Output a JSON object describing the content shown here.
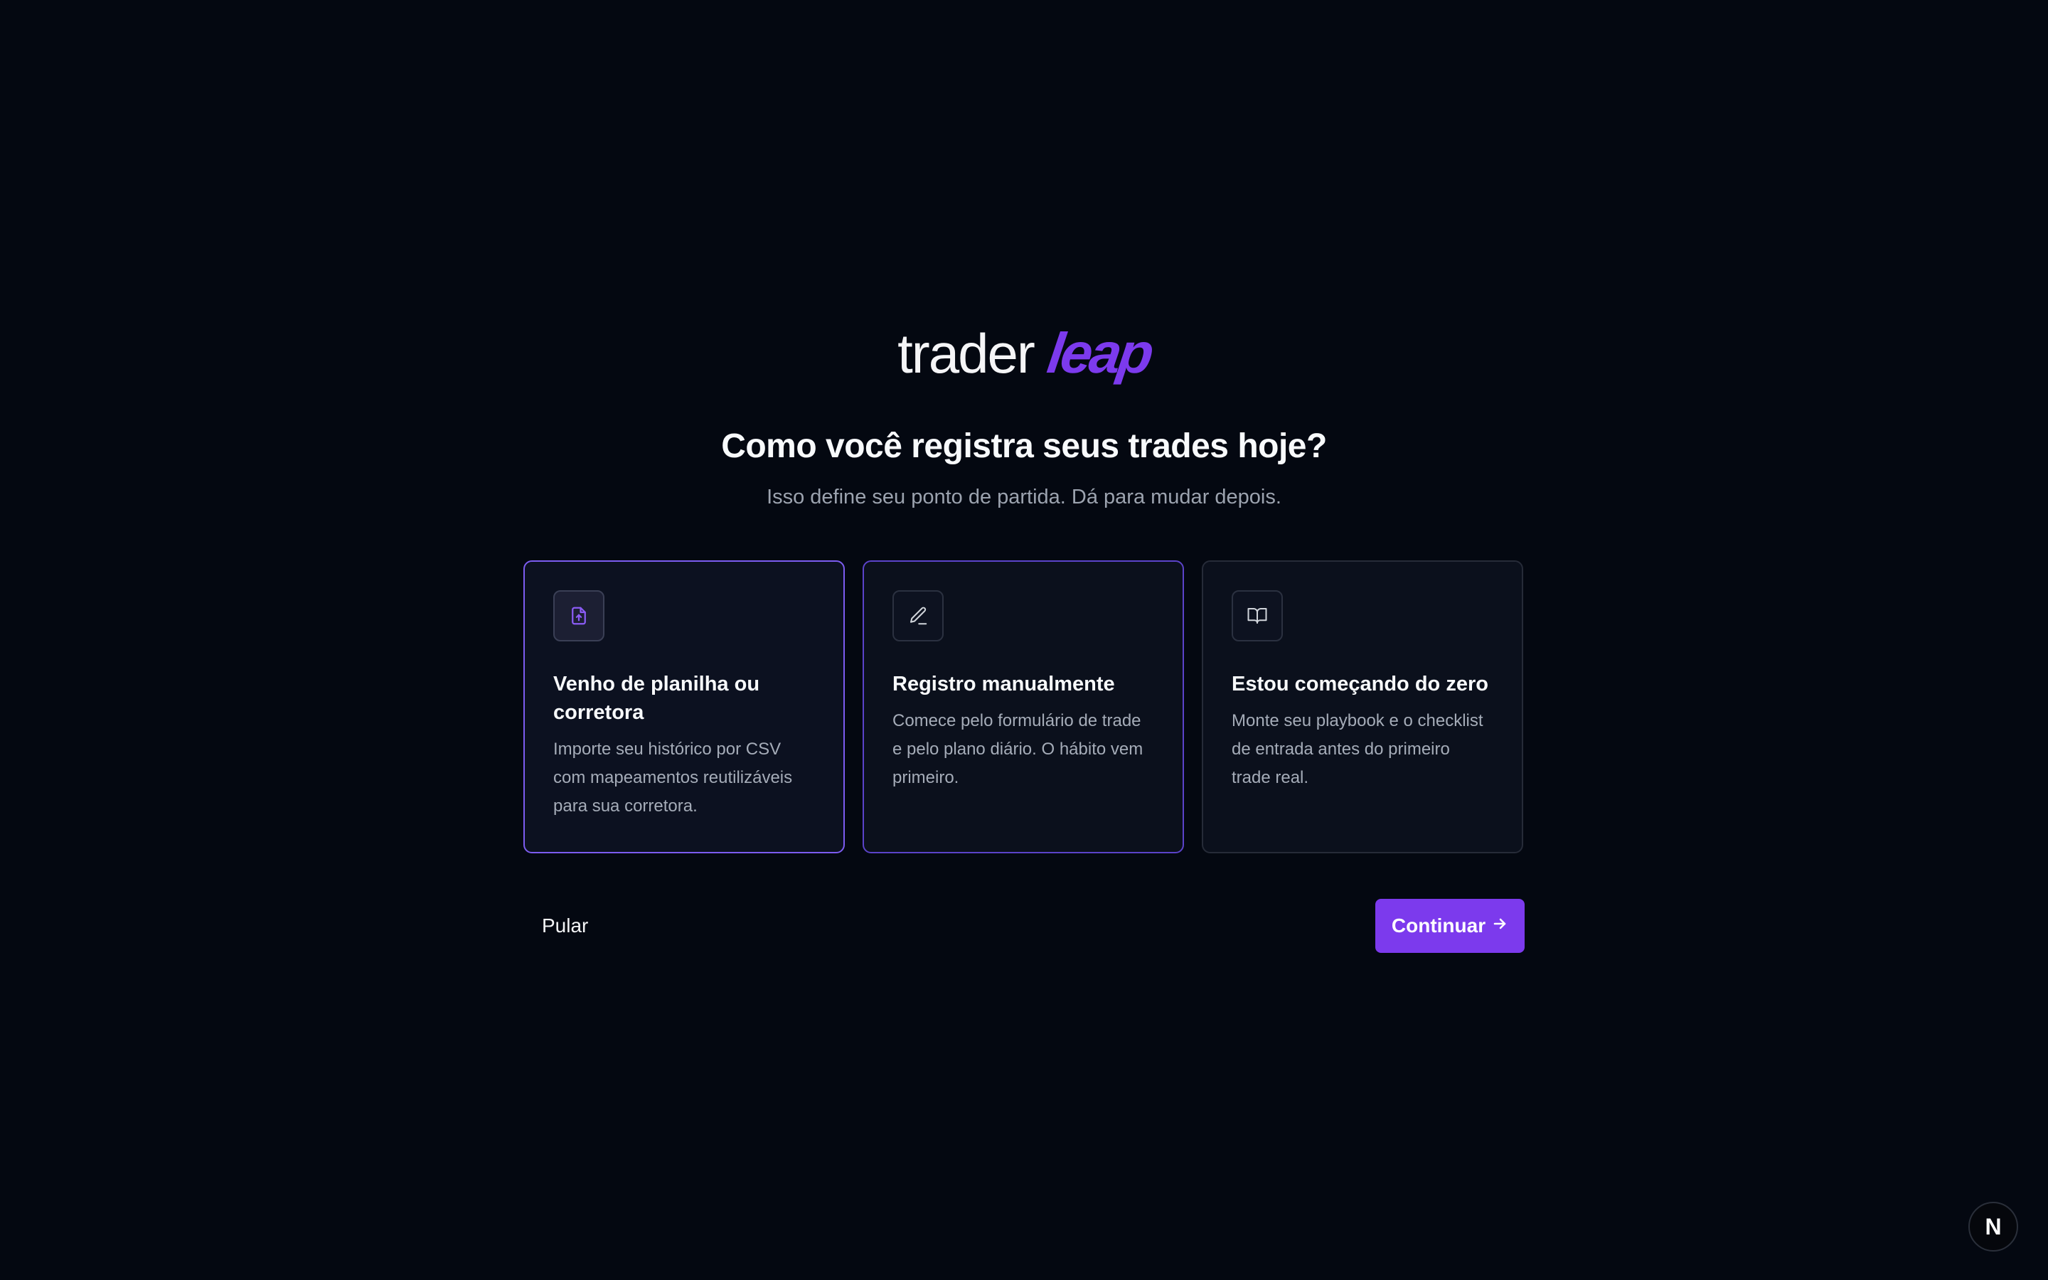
{
  "brand": {
    "part1": "trader",
    "part2": "leap",
    "accent_color": "#7c3aed"
  },
  "header": {
    "title": "Como você registra seus trades hoje?",
    "subtitle": "Isso define seu ponto de partida. Dá para mudar depois."
  },
  "options": [
    {
      "icon": "file-upload-icon",
      "title": "Venho de planilha ou corretora",
      "description": "Importe seu histórico por CSV com mapeamentos reutilizáveis para sua corretora.",
      "selected": true
    },
    {
      "icon": "pencil-icon",
      "title": "Registro manualmente",
      "description": "Comece pelo formulário de trade e pelo plano diário. O hábito vem primeiro.",
      "selected": false
    },
    {
      "icon": "book-open-icon",
      "title": "Estou começando do zero",
      "description": "Monte seu playbook e o checklist de entrada antes do primeiro trade real.",
      "selected": false
    }
  ],
  "actions": {
    "skip_label": "Pular",
    "continue_label": "Continuar",
    "continue_icon": "arrow-right-icon"
  },
  "dev_badge": {
    "label": "N"
  }
}
